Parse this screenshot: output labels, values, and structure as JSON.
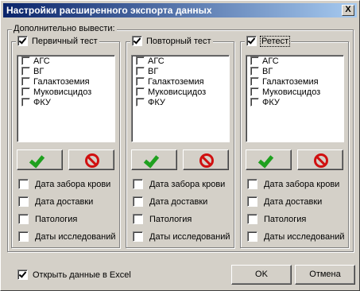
{
  "window": {
    "title": "Настройки расширенного экспорта данных",
    "close_label": "X"
  },
  "group_label": "Дополнительно вывести:",
  "columns": [
    {
      "title": "Первичный тест",
      "checked": true,
      "items": [
        {
          "label": "АГС"
        },
        {
          "label": "ВГ"
        },
        {
          "label": "Галактоземия"
        },
        {
          "label": "Муковисцидоз"
        },
        {
          "label": "ФКУ"
        }
      ],
      "options": [
        {
          "label": "Дата забора крови"
        },
        {
          "label": "Дата доставки"
        },
        {
          "label": "Патология"
        },
        {
          "label": "Даты исследований"
        }
      ]
    },
    {
      "title": "Повторный тест",
      "checked": true,
      "items": [
        {
          "label": "АГС"
        },
        {
          "label": "ВГ"
        },
        {
          "label": "Галактоземия"
        },
        {
          "label": "Муковисцидоз"
        },
        {
          "label": "ФКУ"
        }
      ],
      "options": [
        {
          "label": "Дата забора крови"
        },
        {
          "label": "Дата доставки"
        },
        {
          "label": "Патология"
        },
        {
          "label": "Даты исследований"
        }
      ]
    },
    {
      "title": "Ретест",
      "checked": true,
      "items": [
        {
          "label": "АГС"
        },
        {
          "label": "ВГ"
        },
        {
          "label": "Галактоземия"
        },
        {
          "label": "Муковисцидоз"
        },
        {
          "label": "ФКУ"
        }
      ],
      "options": [
        {
          "label": "Дата забора крови"
        },
        {
          "label": "Дата доставки"
        },
        {
          "label": "Патология"
        },
        {
          "label": "Даты исследований"
        }
      ]
    }
  ],
  "open_excel_label": "Открыть данные в Excel",
  "open_excel_checked": true,
  "ok_label": "OK",
  "cancel_label": "Отмена",
  "icons": {
    "select_all": "checkmark-icon",
    "clear_all": "no-entry-icon"
  }
}
